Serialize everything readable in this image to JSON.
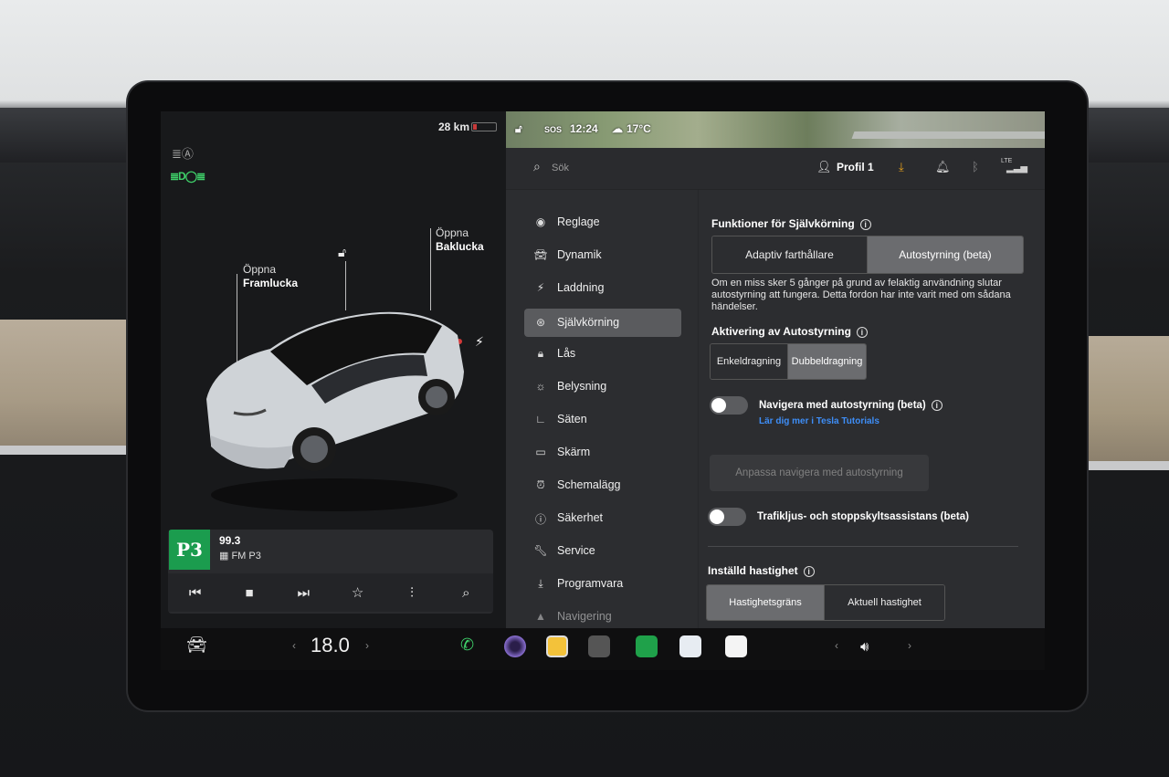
{
  "left_panel": {
    "range": "28 km",
    "frunk": {
      "action": "Öppna",
      "name": "Framlucka"
    },
    "trunk": {
      "action": "Öppna",
      "name": "Baklucka"
    },
    "icons": [
      "headlights-icon",
      "low-beam-icon",
      "battery-icon",
      "lock-open-icon",
      "charge-bolt-icon"
    ]
  },
  "media": {
    "logo": "P3",
    "frequency": "99.3",
    "station": "FM P3",
    "controls": [
      "previous-icon",
      "stop-icon",
      "next-icon",
      "favorite-star-icon",
      "equalizer-icon",
      "search-icon"
    ]
  },
  "status_bar": {
    "sos": "SOS",
    "time": "12:24",
    "temperature": "17°C"
  },
  "topbar": {
    "search_placeholder": "Sök",
    "profile": "Profil 1",
    "lte": "LTE"
  },
  "menu": {
    "items": [
      {
        "label": "Reglage",
        "icon": "toggle-icon"
      },
      {
        "label": "Dynamik",
        "icon": "car-icon"
      },
      {
        "label": "Laddning",
        "icon": "bolt-icon"
      },
      {
        "label": "Självkörning",
        "icon": "steering-wheel-icon",
        "active": true
      },
      {
        "label": "Lås",
        "icon": "lock-icon"
      },
      {
        "label": "Belysning",
        "icon": "sun-icon"
      },
      {
        "label": "Säten",
        "icon": "seat-icon"
      },
      {
        "label": "Skärm",
        "icon": "display-icon"
      },
      {
        "label": "Schemalägg",
        "icon": "alarm-clock-icon"
      },
      {
        "label": "Säkerhet",
        "icon": "alert-circle-icon"
      },
      {
        "label": "Service",
        "icon": "wrench-icon"
      },
      {
        "label": "Programvara",
        "icon": "download-icon"
      },
      {
        "label": "Navigering",
        "icon": "navigation-arrow-icon"
      }
    ]
  },
  "autopilot": {
    "features_title": "Funktioner för Självkörning",
    "features_options": [
      "Adaptiv farthållare",
      "Autostyrning (beta)"
    ],
    "features_selected": "Autostyrning (beta)",
    "description": "Om en miss sker 5 gånger på grund av felaktig användning slutar autostyrning att fungera. Detta fordon har inte varit med om sådana händelser.",
    "activation_title": "Aktivering av Autostyrning",
    "activation_options": [
      "Enkeldragning",
      "Dubbeldragning"
    ],
    "activation_selected": "Dubbeldragning",
    "nav_toggle_label": "Navigera med autostyrning (beta)",
    "nav_toggle_on": false,
    "nav_link": "Lär dig mer i Tesla Tutorials",
    "customize_button": "Anpassa navigera med autostyrning",
    "traffic_toggle_label": "Trafikljus- och stoppskyltsassistans (beta)",
    "traffic_toggle_on": false,
    "speed_title": "Inställd hastighet",
    "speed_options": [
      "Hastighetsgräns",
      "Aktuell hastighet"
    ],
    "speed_selected": "Hastighetsgräns"
  },
  "dock": {
    "temperature": "18.0",
    "apps": [
      "car-icon",
      "phone-icon",
      "camera-icon",
      "app-launcher-icon",
      "dashcam-icon",
      "stocks-icon",
      "navigation-icon",
      "notes-icon",
      "volume-icon"
    ],
    "accent_green": "#3fd16a",
    "accent_blue": "#3e8ef7"
  }
}
